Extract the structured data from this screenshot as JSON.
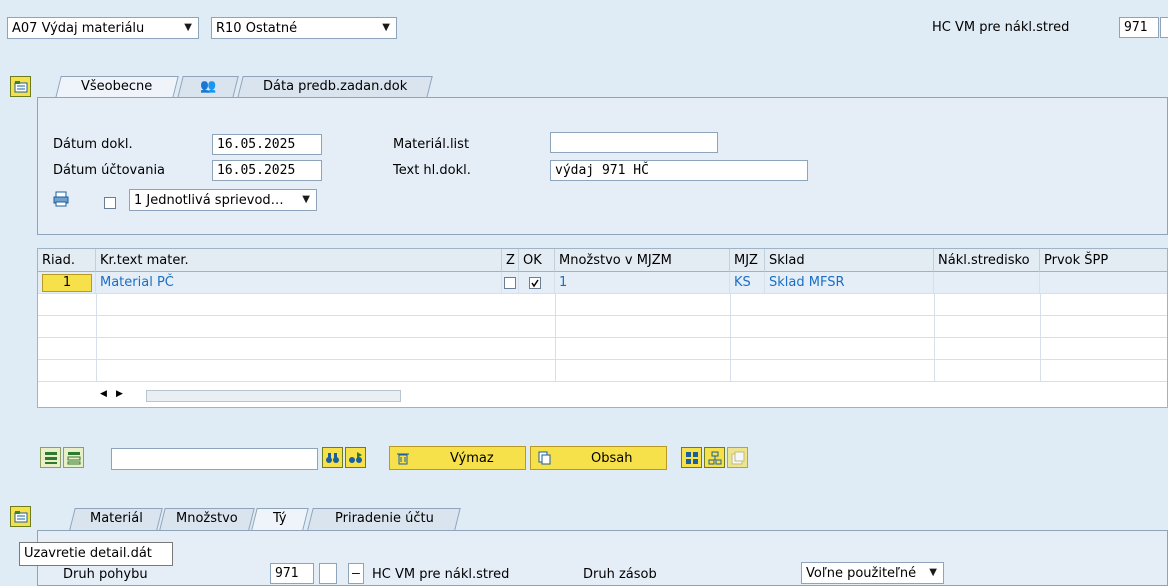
{
  "header": {
    "action_select": "A07 Výdaj materiálu",
    "reference_select": "R10 Ostatné",
    "movement_label": "HC VM pre nákl.stred",
    "movement_code": "971"
  },
  "top_tabs": [
    {
      "label": "Všeobecne",
      "active": true
    },
    {
      "label": "",
      "icon": "partners-icon"
    },
    {
      "label": "Dáta predb.zadan.dok"
    }
  ],
  "general": {
    "doc_date_label": "Dátum dokl.",
    "doc_date": "16.05.2025",
    "posting_date_label": "Dátum účtovania",
    "posting_date": "16.05.2025",
    "material_slip_label": "Materiál.list",
    "material_slip": "",
    "header_text_label": "Text hl.dokl.",
    "header_text": "výdaj 971 HČ",
    "print_option": "1 Jednotlivá sprievod…"
  },
  "items_table": {
    "columns": [
      "Riad.",
      "Kr.text mater.",
      "Z",
      "OK",
      "Množstvo v MJZM",
      "MJZ",
      "Sklad",
      "Nákl.stredisko",
      "Prvok ŠPP"
    ],
    "rows": [
      {
        "line": "1",
        "material": "Material PČ",
        "z": false,
        "ok": true,
        "qty": "1",
        "unit": "KS",
        "storage": "Sklad MFSR",
        "cost_center": "",
        "wbs": ""
      }
    ]
  },
  "toolbar": {
    "delete_label": "Výmaz",
    "contents_label": "Obsah",
    "search_value": ""
  },
  "detail_tabs": [
    "Materiál",
    "Množstvo",
    "Tý",
    "Priradenie účtu"
  ],
  "detail": {
    "movement_type_label": "Druh pohybu",
    "movement_type": "971",
    "movement_text": "HC VM pre nákl.stred",
    "minus_sign": "–",
    "stock_type_label": "Druh zásob",
    "stock_type": "Voľne použiteľné"
  },
  "tooltip": "Uzavretie detail.dát"
}
